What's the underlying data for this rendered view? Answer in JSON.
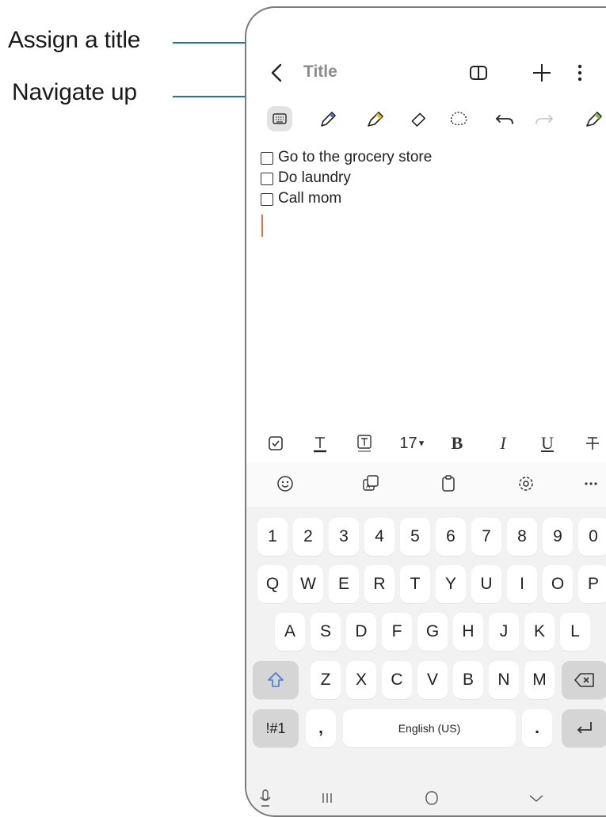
{
  "callouts": {
    "assign_title": "Assign a title",
    "navigate_up": "Navigate up"
  },
  "header": {
    "title_placeholder": "Title",
    "icons": [
      "back-icon",
      "book-view-icon",
      "add-icon",
      "more-options-icon"
    ]
  },
  "toolbar": {
    "tools": [
      "keyboard-icon",
      "pen-icon",
      "highlighter-icon",
      "eraser-icon",
      "lasso-select-icon",
      "undo-icon",
      "redo-icon",
      "pen-settings-icon"
    ]
  },
  "note": {
    "items": [
      {
        "text": "Go to the grocery store",
        "checked": false
      },
      {
        "text": "Do laundry",
        "checked": false
      },
      {
        "text": "Call mom",
        "checked": false
      }
    ]
  },
  "format_bar": {
    "font_size": "17",
    "bold": "B",
    "italic": "I",
    "underline": "U"
  },
  "keyboard": {
    "strip_icons": [
      "emoji-icon",
      "translate-icon",
      "clipboard-icon",
      "settings-icon",
      "more-icon"
    ],
    "row_numbers": [
      "1",
      "2",
      "3",
      "4",
      "5",
      "6",
      "7",
      "8",
      "9",
      "0"
    ],
    "row_q": [
      "Q",
      "W",
      "E",
      "R",
      "T",
      "Y",
      "U",
      "I",
      "O",
      "P"
    ],
    "row_a": [
      "A",
      "S",
      "D",
      "F",
      "G",
      "H",
      "J",
      "K",
      "L"
    ],
    "row_z": [
      "Z",
      "X",
      "C",
      "V",
      "B",
      "N",
      "M"
    ],
    "symbols_label": "!#1",
    "comma": ",",
    "space_label": "English (US)",
    "period": "."
  },
  "nav_bar": {
    "icons": [
      "voice-input-icon",
      "recent-apps-icon",
      "home-icon",
      "hide-keyboard-icon"
    ]
  },
  "colors": {
    "callout_line": "#1b75bb",
    "cursor": "#e8703c",
    "shift_active": "#3b7fd9",
    "keyboard_bg": "#f2f2f2"
  }
}
